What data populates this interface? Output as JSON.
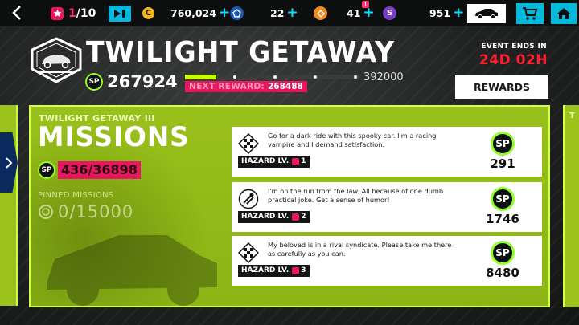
{
  "topbar": {
    "tickets": {
      "current": "1",
      "max": "/10"
    },
    "coins": "760,024",
    "blue_tokens": "22",
    "orange_tokens": "41",
    "notification_count": "!",
    "credits": "951",
    "plus": "+"
  },
  "event": {
    "title": "TWILIGHT GETAWAY",
    "sp_label": "SP",
    "sp_value": "267924",
    "sp_max": "392000",
    "progress_fraction": 0.18,
    "next_reward_label": "NEXT REWARD:",
    "next_reward_value": "268488",
    "ends_label": "EVENT ENDS IN",
    "ends_time": "24D 02H",
    "rewards_button": "REWARDS"
  },
  "missions": {
    "subtitle": "TWILIGHT GETAWAY III",
    "title": "MISSIONS",
    "sp_progress": "436/36898",
    "pinned_label": "PINNED MISSIONS",
    "pinned_value": "0/15000",
    "next_panel_text": "T"
  },
  "mission_cards": [
    {
      "description": "Go for a dark ride with this spooky car. I'm a racing vampire and I demand satisfaction.",
      "hazard_label": "HAZARD LV.",
      "hazard_level": "1",
      "reward": "291",
      "icon": "checkered-flag-icon"
    },
    {
      "description": "I'm on the run from the law. All because of one dumb practical joke. Get a sense of humor!",
      "hazard_label": "HAZARD LV.",
      "hazard_level": "2",
      "reward": "1746",
      "icon": "police-chase-icon"
    },
    {
      "description": "My beloved is in a rival syndicate. Please take me there as carefully as you can.",
      "hazard_label": "HAZARD LV.",
      "hazard_level": "3",
      "reward": "8480",
      "icon": "checkered-flag-icon"
    }
  ],
  "colors": {
    "accent_green": "#c5ff00",
    "panel_green": "#99c01a",
    "accent_pink": "#e6185f",
    "accent_cyan": "#00b9dd",
    "timer_red": "#ff1f2f"
  }
}
